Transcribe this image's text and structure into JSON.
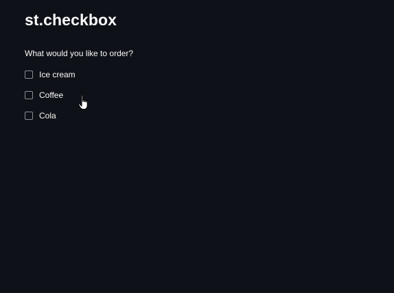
{
  "page": {
    "title": "st.checkbox"
  },
  "form": {
    "question": "What would you like to order?",
    "options": [
      {
        "label": "Ice cream",
        "checked": false
      },
      {
        "label": "Coffee",
        "checked": false
      },
      {
        "label": "Cola",
        "checked": false
      }
    ]
  },
  "colors": {
    "background": "#0e1117",
    "text": "#fafafa",
    "checkbox_border": "#8c8f97"
  },
  "cursor": {
    "icon": "hand-pointer-icon"
  }
}
